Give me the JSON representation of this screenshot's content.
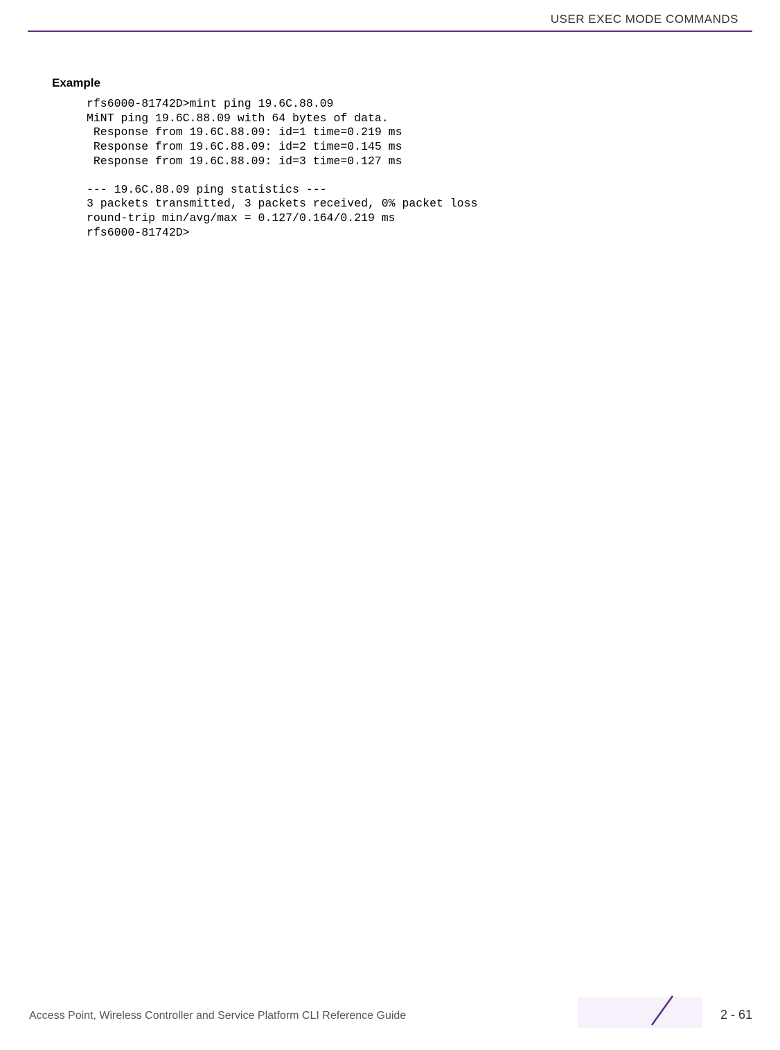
{
  "header": {
    "title": "USER EXEC MODE COMMANDS"
  },
  "section": {
    "heading": "Example",
    "code": "rfs6000-81742D>mint ping 19.6C.88.09\nMiNT ping 19.6C.88.09 with 64 bytes of data.\n Response from 19.6C.88.09: id=1 time=0.219 ms\n Response from 19.6C.88.09: id=2 time=0.145 ms\n Response from 19.6C.88.09: id=3 time=0.127 ms\n\n--- 19.6C.88.09 ping statistics ---\n3 packets transmitted, 3 packets received, 0% packet loss\nround-trip min/avg/max = 0.127/0.164/0.219 ms\nrfs6000-81742D>"
  },
  "footer": {
    "text": "Access Point, Wireless Controller and Service Platform CLI Reference Guide",
    "page": "2 - 61"
  }
}
